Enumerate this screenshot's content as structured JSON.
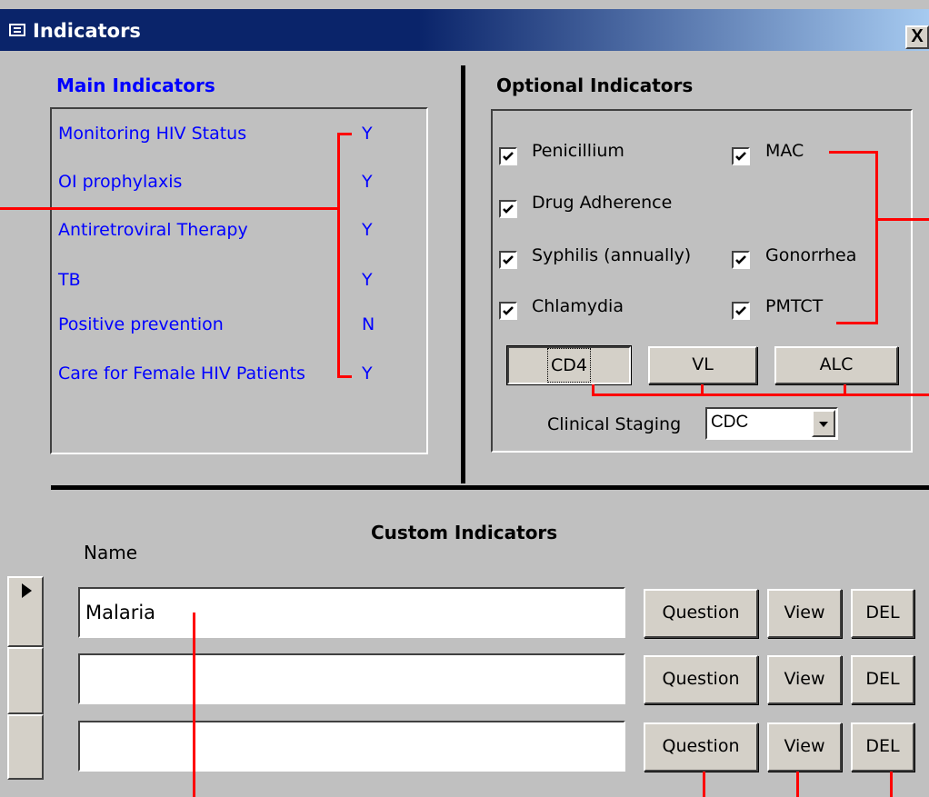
{
  "window": {
    "title": "Indicators",
    "close_label": "X"
  },
  "main_indicators": {
    "heading": "Main Indicators",
    "items": [
      {
        "label": "Monitoring HIV Status",
        "value": "Y"
      },
      {
        "label": "OI prophylaxis",
        "value": "Y"
      },
      {
        "label": "Antiretroviral Therapy",
        "value": "Y"
      },
      {
        "label": "TB",
        "value": "Y"
      },
      {
        "label": "Positive prevention",
        "value": "N"
      },
      {
        "label": "Care for Female HIV Patients",
        "value": "Y"
      }
    ]
  },
  "optional_indicators": {
    "heading": "Optional Indicators",
    "checkboxes": [
      {
        "label": "Penicillium",
        "checked": true
      },
      {
        "label": "MAC",
        "checked": true
      },
      {
        "label": "Drug Adherence",
        "checked": true
      },
      {
        "label": "Syphilis (annually)",
        "checked": true
      },
      {
        "label": "Gonorrhea",
        "checked": true
      },
      {
        "label": "Chlamydia",
        "checked": true
      },
      {
        "label": "PMTCT",
        "checked": true
      }
    ],
    "buttons": {
      "cd4": "CD4",
      "vl": "VL",
      "alc": "ALC"
    },
    "clinical_staging": {
      "label": "Clinical Staging",
      "value": "CDC"
    }
  },
  "custom_indicators": {
    "heading": "Custom Indicators",
    "name_header": "Name",
    "rows": [
      {
        "name": "Malaria",
        "current": true,
        "question": "Question",
        "view": "View",
        "del": "DEL"
      },
      {
        "name": "",
        "current": false,
        "question": "Question",
        "view": "View",
        "del": "DEL"
      },
      {
        "name": "",
        "current": false,
        "question": "Question",
        "view": "View",
        "del": "DEL"
      }
    ]
  },
  "colors": {
    "title_bar": "#0a246a",
    "label_text": "#0000ff",
    "annotation": "#ff0000",
    "face": "#c0c0c0"
  }
}
